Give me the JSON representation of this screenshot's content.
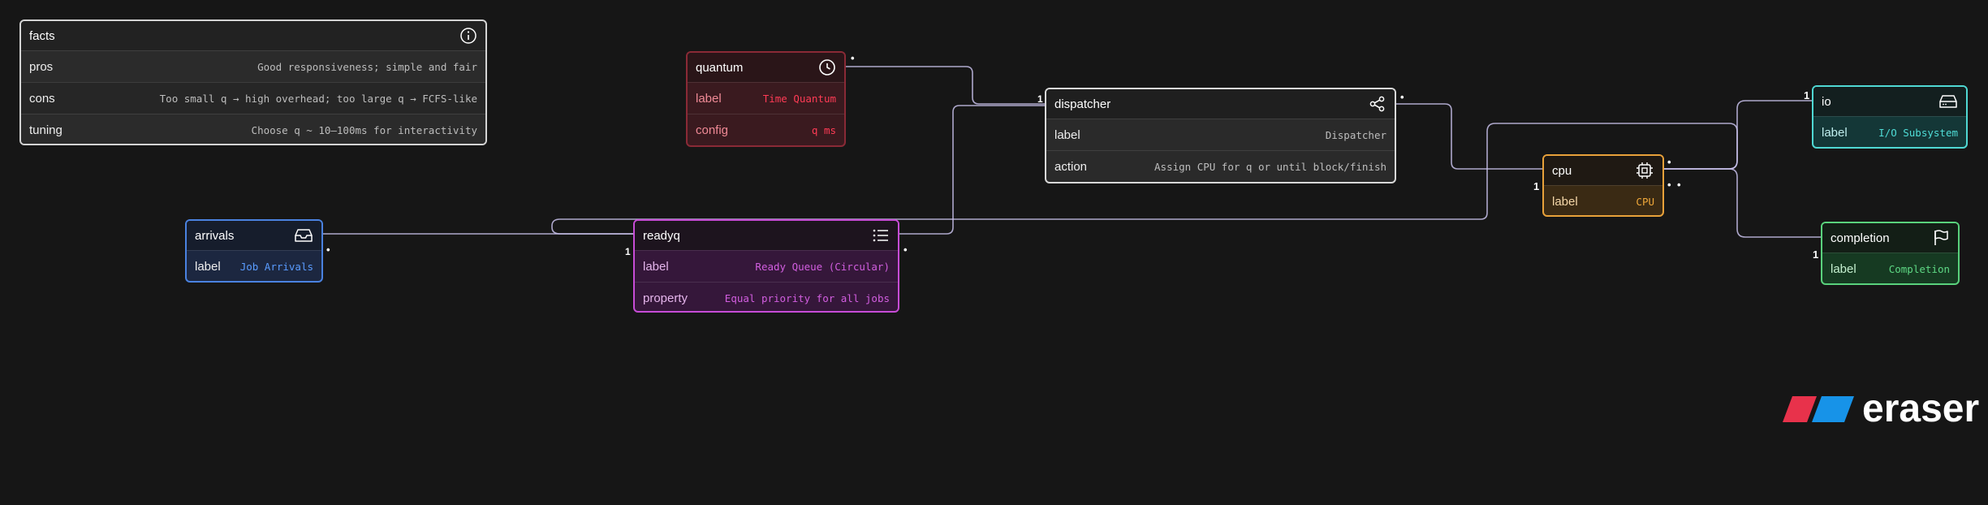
{
  "colors": {
    "background": "#161616",
    "edge": "#c9c2ec",
    "facts": "#d4d4d4",
    "quantum": "#e0344b",
    "dispatcher": "#d8d8d8",
    "arrivals": "#4a82e0",
    "readyq": "#c74cd6",
    "cpu": "#e8a13a",
    "io": "#4fd8d3",
    "completion": "#59d27c"
  },
  "entities": {
    "facts": {
      "title": "facts",
      "icon": "info-icon",
      "rows": [
        {
          "key": "pros",
          "value": "Good responsiveness; simple and fair"
        },
        {
          "key": "cons",
          "value": "Too small q → high overhead; too large q → FCFS-like"
        },
        {
          "key": "tuning",
          "value": "Choose q ~ 10–100ms for interactivity"
        }
      ]
    },
    "quantum": {
      "title": "quantum",
      "icon": "clock-icon",
      "rows": [
        {
          "key": "label",
          "value": "Time Quantum"
        },
        {
          "key": "config",
          "value": "q ms"
        }
      ]
    },
    "dispatcher": {
      "title": "dispatcher",
      "icon": "share-icon",
      "rows": [
        {
          "key": "label",
          "value": "Dispatcher"
        },
        {
          "key": "action",
          "value": "Assign CPU for q or until block/finish"
        }
      ]
    },
    "arrivals": {
      "title": "arrivals",
      "icon": "inbox-icon",
      "rows": [
        {
          "key": "label",
          "value": "Job Arrivals"
        }
      ]
    },
    "readyq": {
      "title": "readyq",
      "icon": "list-icon",
      "rows": [
        {
          "key": "label",
          "value": "Ready Queue (Circular)"
        },
        {
          "key": "property",
          "value": "Equal priority for all jobs"
        }
      ]
    },
    "cpu": {
      "title": "cpu",
      "icon": "chip-icon",
      "rows": [
        {
          "key": "label",
          "value": "CPU"
        }
      ]
    },
    "io": {
      "title": "io",
      "icon": "hard-drive-icon",
      "rows": [
        {
          "key": "label",
          "value": "I/O Subsystem"
        }
      ]
    },
    "completion": {
      "title": "completion",
      "icon": "flag-icon",
      "rows": [
        {
          "key": "label",
          "value": "Completion"
        }
      ]
    }
  },
  "cardinality": {
    "one": "1",
    "many": "•",
    "double": "1 1"
  },
  "brand": {
    "name": "eraser"
  }
}
